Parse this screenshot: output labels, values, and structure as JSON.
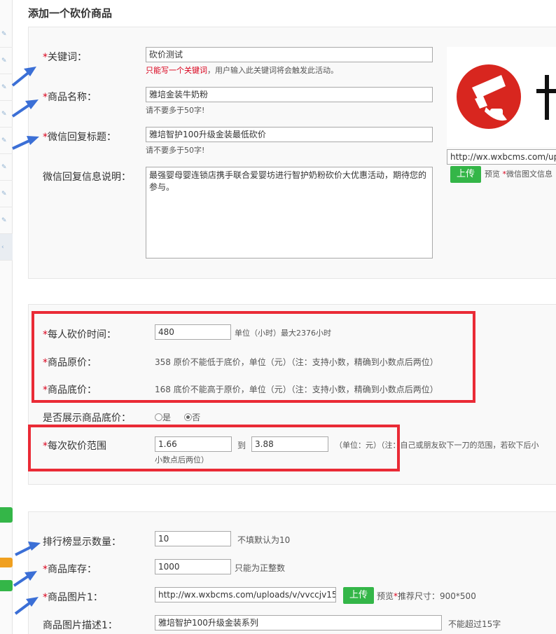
{
  "page": {
    "title": "添加一个砍价商品"
  },
  "basic": {
    "keyword_label": "关键词：",
    "keyword_value": "砍价测试",
    "keyword_hint_red": "只能写一个关键词",
    "keyword_hint": "，用户输入此关键词将会触发此活动。",
    "name_label": "商品名称：",
    "name_value": "雅培金装牛奶粉",
    "name_hint": "请不要多于50字!",
    "reply_title_label": "微信回复标题：",
    "reply_title_value": "雅培智护100升级金装最低砍价",
    "reply_title_hint": "请不要多于50字!",
    "reply_desc_label": "微信回复信息说明：",
    "reply_desc_value": "最强婴母婴连锁店携手联合爱婴坊进行智护奶粉砍价大优惠活动，期待您的参与。",
    "cover_url": "http://wx.wxbcms.com/upl",
    "upload_label": "上传",
    "preview_label": "预览",
    "cover_hint": "微信图文信息"
  },
  "price": {
    "time_label": "每人砍价时间：",
    "time_value": "480",
    "time_hint": "单位（小时）最大2376小时",
    "orig_label": "商品原价：",
    "orig_text": "358 原价不能低于底价，单位（元）（注：支持小数，精确到小数点后两位）",
    "floor_label": "商品底价：",
    "floor_text": "168 底价不能高于原价，单位（元）（注：支持小数，精确到小数点后两位）",
    "show_floor_label": "是否展示商品底价：",
    "yes_label": "是",
    "no_label": "否",
    "range_label": "每次砍价范围",
    "range_min": "1.66",
    "range_to": "到",
    "range_max": "3.88",
    "range_hint": "（单位：元）（注：自己或朋友砍下一刀的范围，若砍下后小",
    "range_hint2": "小数点后两位）"
  },
  "stock": {
    "rank_label": "排行榜显示数量：",
    "rank_value": "10",
    "rank_hint": "不填默认为10",
    "stock_label": "商品库存：",
    "stock_value": "1000",
    "stock_hint": "只能为正整数",
    "image_label": "商品图片1：",
    "image_value": "http://wx.wxbcms.com/uploads/v/vvccjv150",
    "upload_label": "上传",
    "preview_label": "预览",
    "image_hint": "推荐尺寸：900*500",
    "image_desc_label": "商品图片描述1：",
    "image_desc_value": "雅培智护100升级金装系列",
    "image_desc_hint": "不能超过15字"
  },
  "colors": {
    "red": "#ea2b36",
    "green": "#34b648",
    "arrow": "#3b6fd6"
  }
}
